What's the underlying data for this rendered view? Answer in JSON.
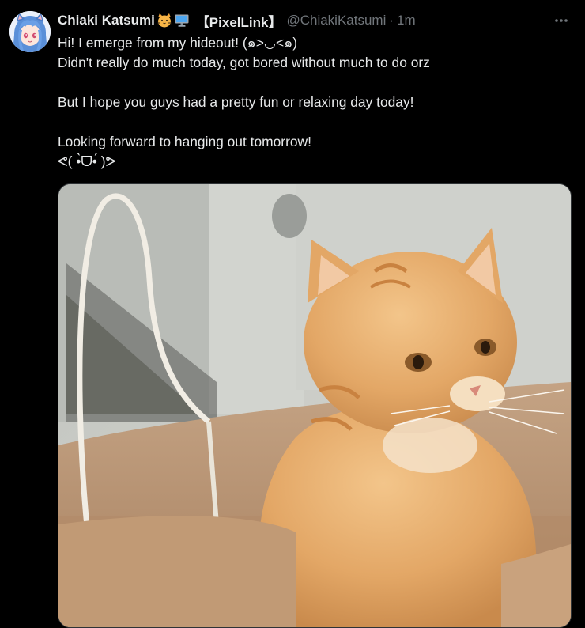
{
  "author": {
    "display_name": "Chiaki Katsumi",
    "name_emojis": [
      "cat-face-icon",
      "desktop-computer-icon"
    ],
    "tag": "【PixelLink】",
    "handle": "@ChiakiKatsumi",
    "separator": "·",
    "timestamp": "1m"
  },
  "tweet": {
    "lines": [
      "Hi! I emerge from my hideout! (๑>◡<๑)",
      "Didn't really do much today, got bored without much to do orz",
      "",
      "But I hope you guys had a pretty fun or relaxing day today!",
      "",
      "Looking forward to hanging out tomorrow!",
      "ᕙ( •̀ᗜ•́ )ᕗ"
    ]
  },
  "media": {
    "icon": "orange-cat-in-paper-bag-photo"
  },
  "colors": {
    "background": "#000000",
    "text_primary": "#e7e9ea",
    "text_secondary": "#71767b",
    "border": "#2f3336"
  }
}
